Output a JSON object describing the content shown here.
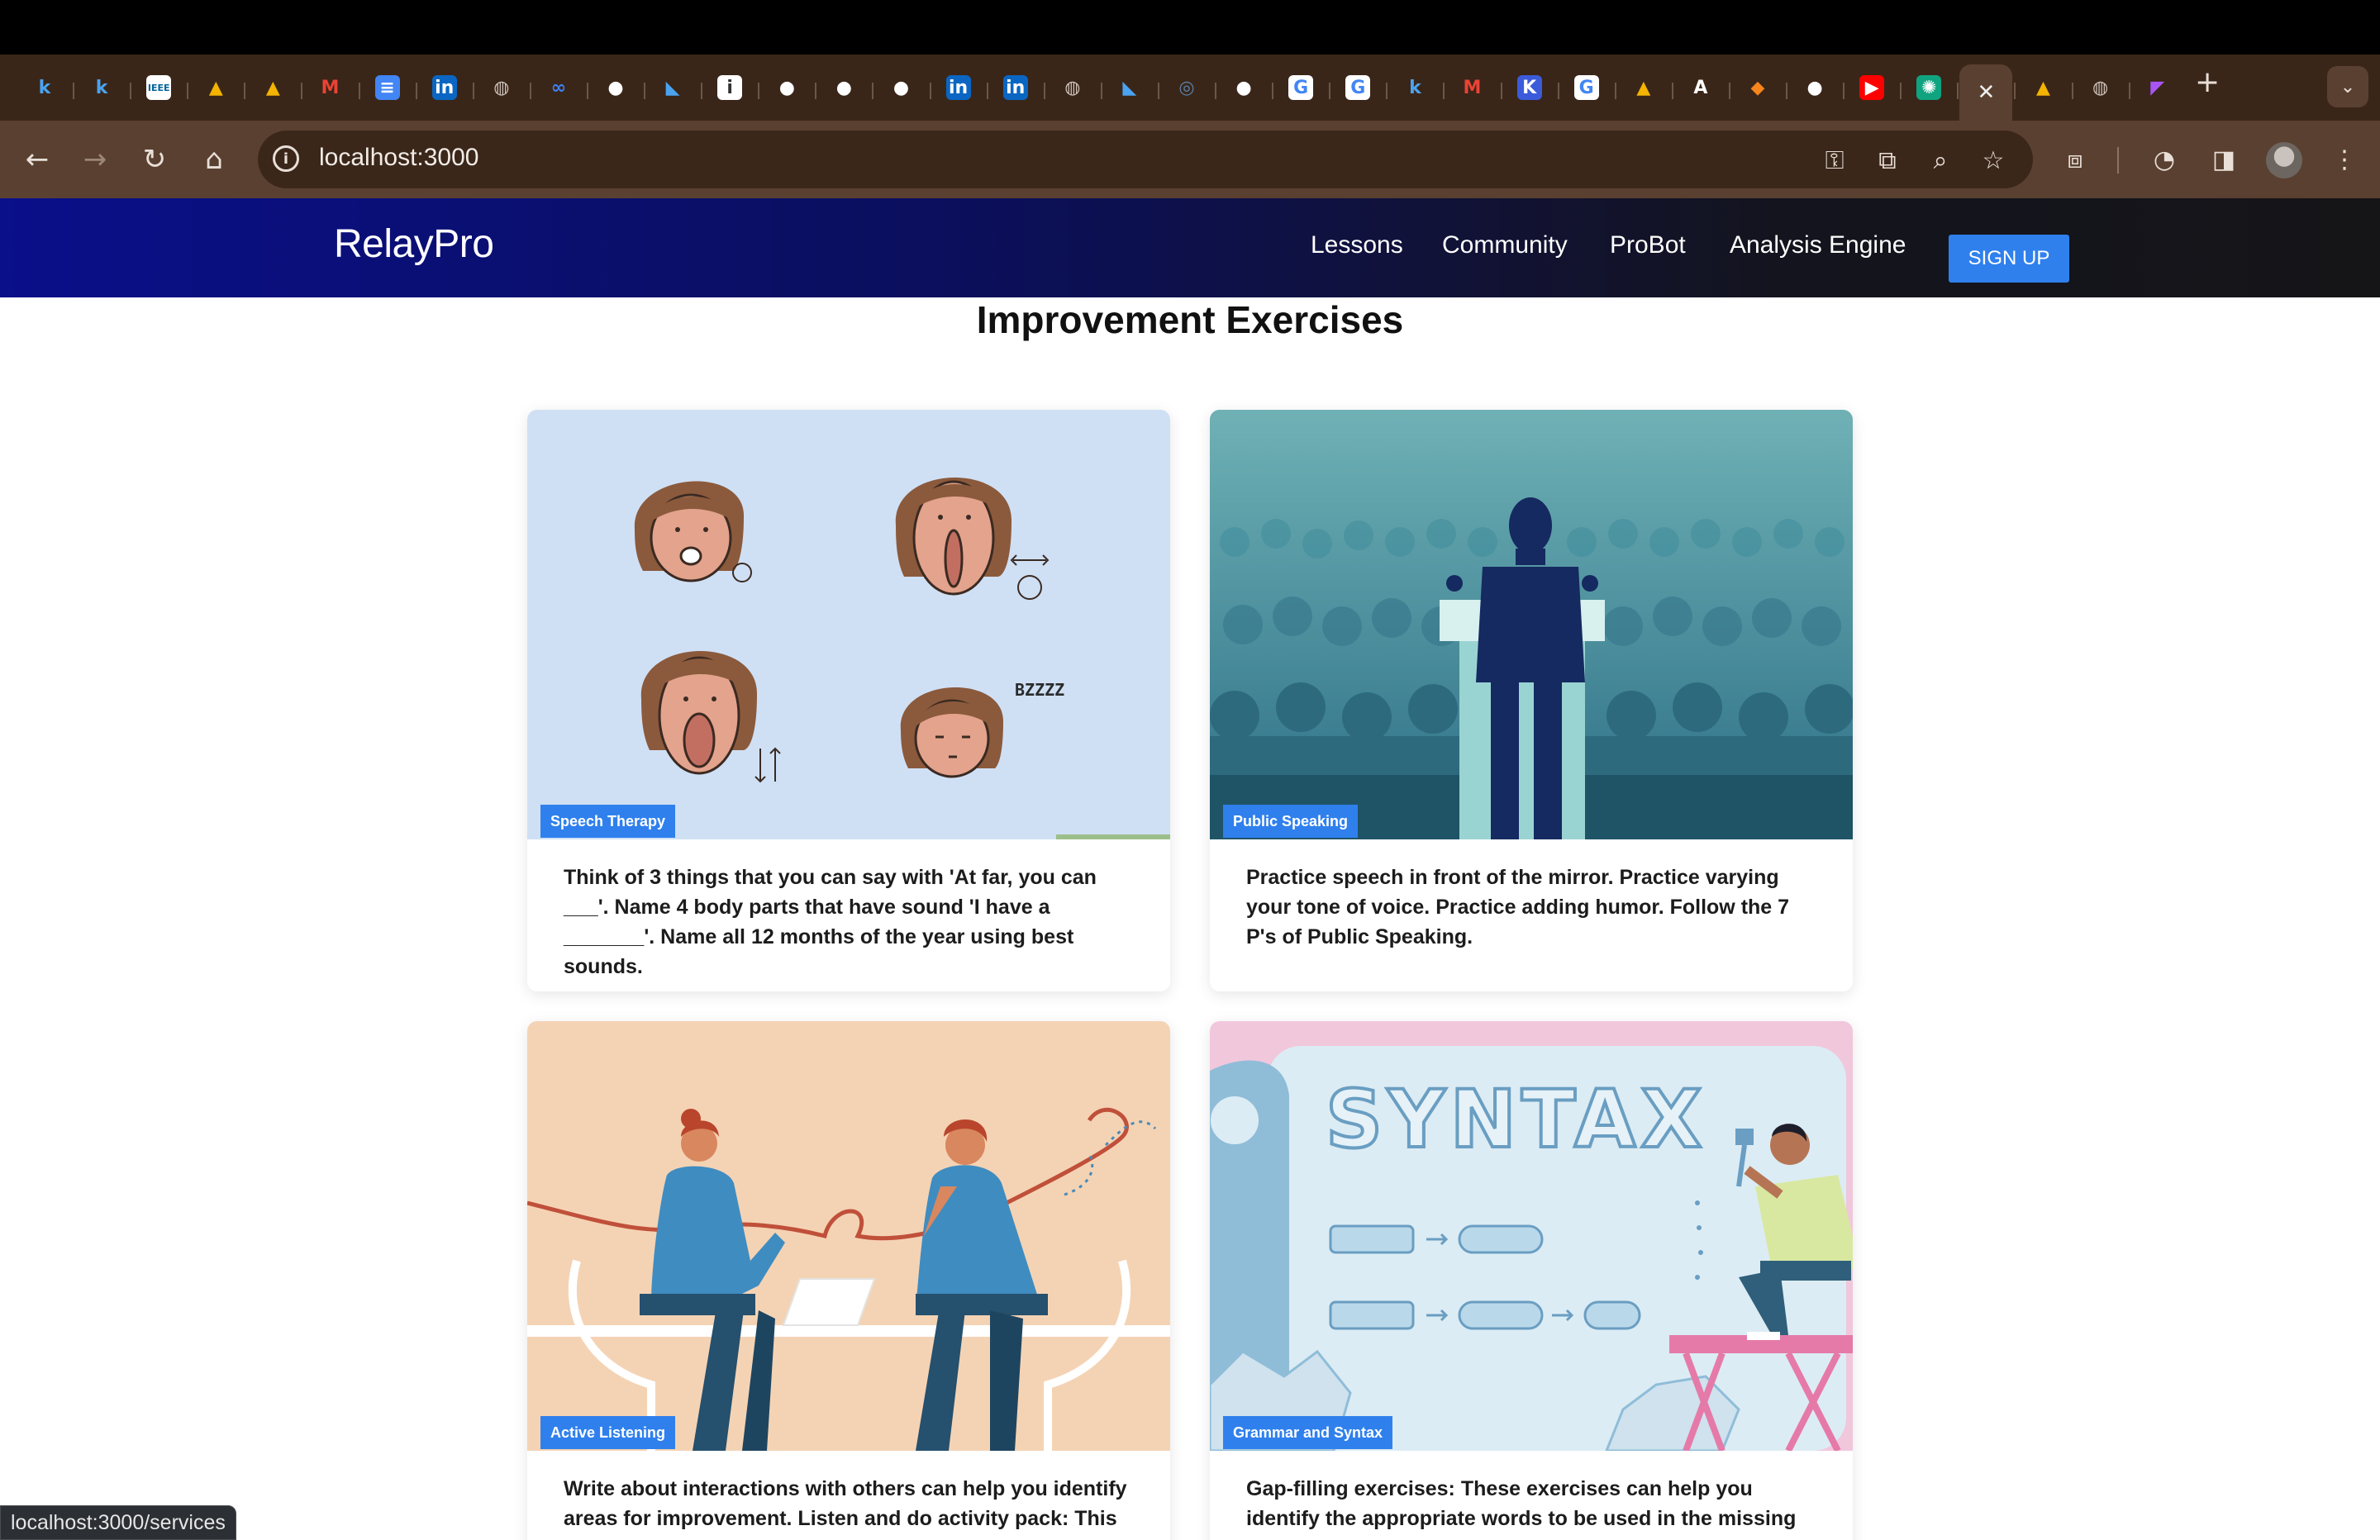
{
  "browser": {
    "tabs": [
      {
        "icon": "k-icon",
        "glyph": "k",
        "bg": "#3a2619",
        "fg": "#4aa3f0"
      },
      {
        "icon": "k-icon",
        "glyph": "k",
        "bg": "#3a2619",
        "fg": "#4aa3f0"
      },
      {
        "icon": "ieee-icon",
        "glyph": "IEEE",
        "bg": "#ffffff",
        "fg": "#00629b"
      },
      {
        "icon": "google-drive-icon",
        "glyph": "▲",
        "bg": "#3a2619",
        "fg": "#f4b400"
      },
      {
        "icon": "google-drive-icon",
        "glyph": "▲",
        "bg": "#3a2619",
        "fg": "#f4b400"
      },
      {
        "icon": "gmail-icon",
        "glyph": "M",
        "bg": "#3a2619",
        "fg": "#ea4335"
      },
      {
        "icon": "google-docs-icon",
        "glyph": "≡",
        "bg": "#4285f4",
        "fg": "#ffffff"
      },
      {
        "icon": "linkedin-icon",
        "glyph": "in",
        "bg": "#0a66c2",
        "fg": "#ffffff"
      },
      {
        "icon": "globe-icon",
        "glyph": "◍",
        "bg": "#3a2619",
        "fg": "#cfc4bb"
      },
      {
        "icon": "meta-icon",
        "glyph": "∞",
        "bg": "#3a2619",
        "fg": "#3b82f6"
      },
      {
        "icon": "github-icon",
        "glyph": "●",
        "bg": "#3a2619",
        "fg": "#ffffff"
      },
      {
        "icon": "bird-icon",
        "glyph": "◣",
        "bg": "#3a2619",
        "fg": "#4aa3f0"
      },
      {
        "icon": "info-icon",
        "glyph": "i",
        "bg": "#ffffff",
        "fg": "#333333"
      },
      {
        "icon": "github-icon",
        "glyph": "●",
        "bg": "#3a2619",
        "fg": "#ffffff"
      },
      {
        "icon": "github-icon",
        "glyph": "●",
        "bg": "#3a2619",
        "fg": "#ffffff"
      },
      {
        "icon": "github-icon",
        "glyph": "●",
        "bg": "#3a2619",
        "fg": "#ffffff"
      },
      {
        "icon": "linkedin-icon",
        "glyph": "in",
        "bg": "#0a66c2",
        "fg": "#ffffff"
      },
      {
        "icon": "linkedin-icon",
        "glyph": "in",
        "bg": "#0a66c2",
        "fg": "#ffffff"
      },
      {
        "icon": "globe-icon",
        "glyph": "◍",
        "bg": "#3a2619",
        "fg": "#cfc4bb"
      },
      {
        "icon": "bird-icon",
        "glyph": "◣",
        "bg": "#3a2619",
        "fg": "#4aa3f0"
      },
      {
        "icon": "circle-icon",
        "glyph": "◎",
        "bg": "#3a2619",
        "fg": "#5a7fa8"
      },
      {
        "icon": "github-icon",
        "glyph": "●",
        "bg": "#3a2619",
        "fg": "#ffffff"
      },
      {
        "icon": "google-icon",
        "glyph": "G",
        "bg": "#ffffff",
        "fg": "#4285f4"
      },
      {
        "icon": "google-icon",
        "glyph": "G",
        "bg": "#ffffff",
        "fg": "#4285f4"
      },
      {
        "icon": "k-icon",
        "glyph": "k",
        "bg": "#3a2619",
        "fg": "#4aa3f0"
      },
      {
        "icon": "gmail-icon",
        "glyph": "M",
        "bg": "#3a2619",
        "fg": "#ea4335"
      },
      {
        "icon": "kotlin-icon",
        "glyph": "K",
        "bg": "#3b5bdb",
        "fg": "#ffffff"
      },
      {
        "icon": "google-icon",
        "glyph": "G",
        "bg": "#ffffff",
        "fg": "#4285f4"
      },
      {
        "icon": "google-drive-icon",
        "glyph": "▲",
        "bg": "#3a2619",
        "fg": "#f4b400"
      },
      {
        "icon": "a-icon",
        "glyph": "A",
        "bg": "#3a2619",
        "fg": "#ffffff"
      },
      {
        "icon": "fox-icon",
        "glyph": "◆",
        "bg": "#3a2619",
        "fg": "#f6851b"
      },
      {
        "icon": "github-icon",
        "glyph": "●",
        "bg": "#3a2619",
        "fg": "#ffffff"
      },
      {
        "icon": "youtube-icon",
        "glyph": "▶",
        "bg": "#ff0000",
        "fg": "#ffffff"
      },
      {
        "icon": "chatgpt-icon",
        "glyph": "✺",
        "bg": "#10a37f",
        "fg": "#ffffff"
      },
      {
        "icon": "close-icon",
        "glyph": "✕",
        "bg": "transparent",
        "fg": "#eeeeee",
        "active": true
      },
      {
        "icon": "google-drive-icon",
        "glyph": "▲",
        "bg": "#3a2619",
        "fg": "#f4b400"
      },
      {
        "icon": "globe-icon",
        "glyph": "◍",
        "bg": "#3a2619",
        "fg": "#cfc4bb"
      },
      {
        "icon": "slack-icon",
        "glyph": "◤",
        "bg": "#3a2619",
        "fg": "#a855f7"
      }
    ],
    "new_tab_glyph": "+",
    "tab_search_glyph": "⌄",
    "url": "localhost:3000",
    "status_url": "localhost:3000/services"
  },
  "nav": {
    "brand": "RelayPro",
    "links": [
      "Lessons",
      "Community",
      "ProBot",
      "Analysis Engine"
    ],
    "signup": "SIGN UP"
  },
  "page": {
    "title": "Improvement Exercises",
    "cards": [
      {
        "tag": "Speech Therapy",
        "text": "Think of 3 things that you can say with 'At far, you can ___'. Name 4 body parts that have sound 'I have a _______'. Name all 12 months of the year using best sounds.",
        "illustration_label": "BZZZZ"
      },
      {
        "tag": "Public Speaking",
        "text": "Practice speech in front of the mirror. Practice varying your tone of voice. Practice adding humor. Follow the 7 P's of Public Speaking."
      },
      {
        "tag": "Active Listening",
        "text": "Write about interactions with others can help you identify areas for improvement. Listen and do activity pack: This"
      },
      {
        "tag": "Grammar and Syntax",
        "text": "Gap-filling exercises: These exercises can help you identify the appropriate words to be used in the missing places.",
        "illustration_label": "SYNTAX"
      }
    ]
  },
  "colors": {
    "accent": "#2f80ed",
    "nav_start": "#0a0f8a",
    "nav_end": "#151518"
  }
}
